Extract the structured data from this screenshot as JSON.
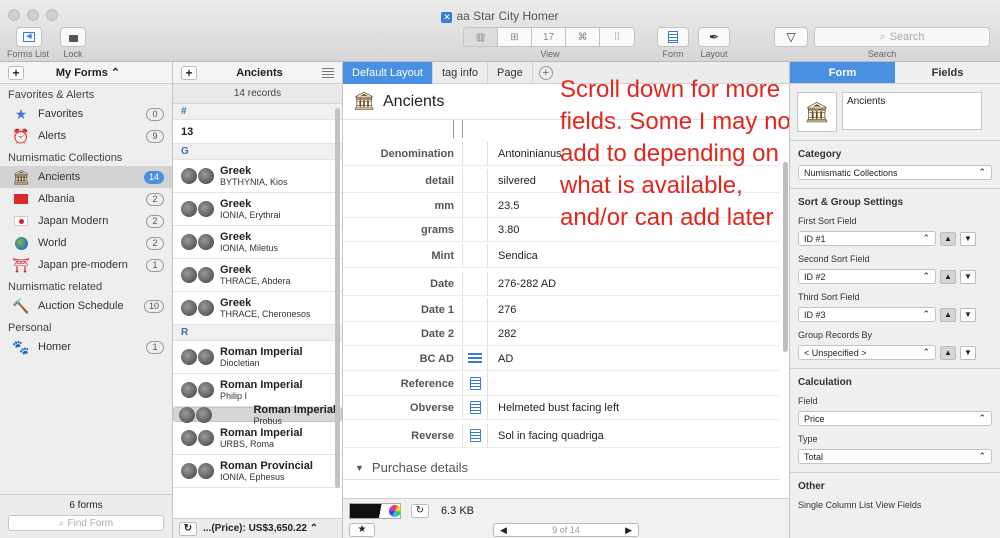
{
  "window": {
    "title": "aa Star City Homer"
  },
  "toolbar": {
    "forms_list_label": "Forms List",
    "lock_label": "Lock",
    "view_label": "View",
    "form_label": "Form",
    "layout_label": "Layout",
    "search_label": "Search",
    "search_placeholder": "Search",
    "view_seg": [
      "▥",
      "⊞",
      "17",
      "⌘",
      "⁞⁞"
    ]
  },
  "sidebar": {
    "title": "My Forms ⌃",
    "sections": [
      {
        "title": "Favorites & Alerts",
        "items": [
          {
            "label": "Favorites",
            "count": "0",
            "icon": "star-icon"
          },
          {
            "label": "Alerts",
            "count": "9",
            "icon": "alarm-clock-icon"
          }
        ]
      },
      {
        "title": "Numismatic Collections",
        "items": [
          {
            "label": "Ancients",
            "count": "14",
            "icon": "temple-icon",
            "selected": true
          },
          {
            "label": "Albania",
            "count": "2",
            "icon": "albania-flag-icon"
          },
          {
            "label": "Japan Modern",
            "count": "2",
            "icon": "japan-flag-icon"
          },
          {
            "label": "World",
            "count": "2",
            "icon": "globe-icon"
          },
          {
            "label": "Japan pre-modern",
            "count": "1",
            "icon": "torii-icon"
          }
        ]
      },
      {
        "title": "Numismatic related",
        "items": [
          {
            "label": "Auction Schedule",
            "count": "10",
            "icon": "gavel-icon"
          }
        ]
      },
      {
        "title": "Personal",
        "items": [
          {
            "label": "Homer",
            "count": "1",
            "icon": "paw-icon"
          }
        ]
      }
    ],
    "footer_count": "6 forms",
    "find_placeholder": "Find Form"
  },
  "records": {
    "title": "Ancients",
    "count": "14 records",
    "groups": [
      {
        "letter": "#",
        "items": [
          {
            "title": "13",
            "plain": true
          }
        ]
      },
      {
        "letter": "G",
        "items": [
          {
            "title": "Greek",
            "sub": "BYTHYNIA, Kios"
          },
          {
            "title": "Greek",
            "sub": "IONIA, Erythrai"
          },
          {
            "title": "Greek",
            "sub": "IONIA, Miletus"
          },
          {
            "title": "Greek",
            "sub": "THRACE, Abdera"
          },
          {
            "title": "Greek",
            "sub": "THRACE, Cheronesos"
          }
        ]
      },
      {
        "letter": "R",
        "items": [
          {
            "title": "Roman Imperial",
            "sub": "Diocletian"
          },
          {
            "title": "Roman Imperial",
            "sub": "Philip I"
          },
          {
            "title": "Roman Imperial",
            "sub": "Probus",
            "selected": true
          },
          {
            "title": "Roman Imperial",
            "sub": "URBS, Roma"
          },
          {
            "title": "Roman Provincial",
            "sub": "IONIA, Ephesus"
          }
        ]
      }
    ],
    "footer_total": "...(Price): US$3,650.22 ⌃"
  },
  "form": {
    "tabs": [
      "Default Layout",
      "tag info",
      "Page"
    ],
    "title": "Ancients",
    "fields": [
      {
        "label": "Denomination",
        "value": "Antoninianus",
        "icon": ""
      },
      {
        "label": "detail",
        "value": "silvered",
        "icon": ""
      },
      {
        "label": "mm",
        "value": "23.5",
        "icon": ""
      },
      {
        "label": "grams",
        "value": "3.80",
        "icon": ""
      },
      {
        "label": "Mint",
        "value": "Sendica",
        "icon": ""
      },
      {
        "label": "Date",
        "value": "276-282 AD",
        "icon": ""
      },
      {
        "label": "Date 1",
        "value": "276",
        "icon": ""
      },
      {
        "label": "Date 2",
        "value": "282",
        "icon": ""
      },
      {
        "label": "BC AD",
        "value": "AD",
        "icon": "list-icon"
      },
      {
        "label": "Reference",
        "value": "",
        "icon": "note-icon"
      },
      {
        "label": "Obverse",
        "value": "Helmeted bust facing left",
        "icon": "note-icon"
      },
      {
        "label": "Reverse",
        "value": "Sol in facing quadriga",
        "icon": "note-icon"
      }
    ],
    "section_title": "Purchase details",
    "annotation": "Scroll down for more fields.  Some I may not add to depending on what is available, and/or can add later",
    "file_size": "6.3 KB",
    "pager": "9 of 14"
  },
  "inspector": {
    "tabs": [
      "Form",
      "Fields"
    ],
    "name_value": "Ancients",
    "category_label": "Category",
    "category_value": "Numismatic Collections",
    "sort_group_label": "Sort & Group Settings",
    "sort_fields": [
      {
        "label": "First Sort Field",
        "value": "ID #1"
      },
      {
        "label": "Second Sort Field",
        "value": "ID #2"
      },
      {
        "label": "Third Sort Field",
        "value": "ID #3"
      }
    ],
    "group_by_label": "Group Records By",
    "group_by_value": "< Unspecified >",
    "calculation_label": "Calculation",
    "field_label": "Field",
    "field_value": "Price",
    "type_label": "Type",
    "type_value": "Total",
    "other_label": "Other",
    "single_column_label": "Single Column List View Fields"
  }
}
